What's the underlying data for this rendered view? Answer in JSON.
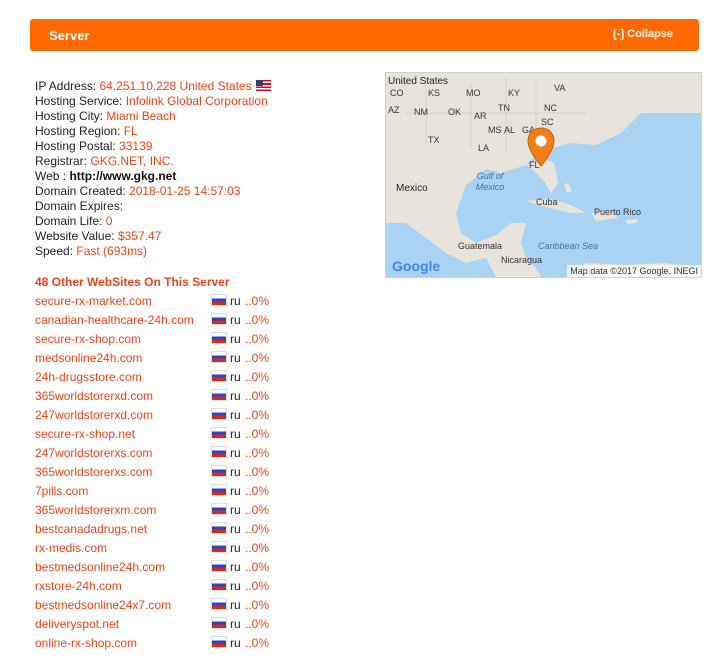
{
  "header": {
    "title": "Server",
    "collapse": "[-] Collapse"
  },
  "info": {
    "ip_label": "IP Address: ",
    "ip_value": "64.251.10.228 United States",
    "hosting_service_label": "Hosting Service: ",
    "hosting_service_value": "Infolink Global Corporation",
    "hosting_city_label": "Hosting City: ",
    "hosting_city_value": "Miami Beach",
    "hosting_region_label": "Hosting Region: ",
    "hosting_region_value": "FL",
    "hosting_postal_label": "Hosting Postal: ",
    "hosting_postal_value": "33139",
    "registrar_label": "Registrar: ",
    "registrar_value": "GKG.NET, INC.",
    "web_label": "Web : ",
    "web_value": "http://www.gkg.net",
    "domain_created_label": "Domain Created: ",
    "domain_created_value": "2018-01-25 14:57:03",
    "domain_expires_label": "Domain Expires:",
    "domain_life_label": "Domain Life: ",
    "domain_life_value": "0",
    "website_value_label": "Website Value: ",
    "website_value_value": "$357.47",
    "speed_label": "Speed: ",
    "speed_value": "Fast (693ms)"
  },
  "map": {
    "labels": {
      "us": "United States",
      "co": "CO",
      "ks": "KS",
      "mo": "MO",
      "ky": "KY",
      "va": "VA",
      "az": "AZ",
      "nm": "NM",
      "ok": "OK",
      "ar": "AR",
      "tn": "TN",
      "nc": "NC",
      "sc": "SC",
      "tx": "TX",
      "ms": "MS",
      "al": "AL",
      "ga": "GA",
      "la": "LA",
      "fl": "FL",
      "gulf": "Gulf of Mexico",
      "mexico": "Mexico",
      "cuba": "Cuba",
      "puerto_rico": "Puerto Rico",
      "guatemala": "Guatemala",
      "nicaragua": "Nicaragua",
      "caribbean": "Caribbean Sea"
    },
    "google": "Google",
    "attribution": "Map data ©2017 Google, INEGI",
    "marker_color": "#f07f1a"
  },
  "sites": {
    "title": "48 Other WebSites On This Server",
    "items": [
      {
        "domain": "secure-rx-market.com",
        "cc": "ru",
        "pct": "..0%"
      },
      {
        "domain": "canadian-healthcare-24h.com",
        "cc": "ru",
        "pct": "..0%"
      },
      {
        "domain": "secure-rx-shop.com",
        "cc": "ru",
        "pct": "..0%"
      },
      {
        "domain": "medsonline24h.com",
        "cc": "ru",
        "pct": "..0%"
      },
      {
        "domain": "24h-drugsstore.com",
        "cc": "ru",
        "pct": "..0%"
      },
      {
        "domain": "365worldstorerxd.com",
        "cc": "ru",
        "pct": "..0%"
      },
      {
        "domain": "247worldstorerxd.com",
        "cc": "ru",
        "pct": "..0%"
      },
      {
        "domain": "secure-rx-shop.net",
        "cc": "ru",
        "pct": "..0%"
      },
      {
        "domain": "247worldstorerxs.com",
        "cc": "ru",
        "pct": "..0%"
      },
      {
        "domain": "365worldstorerxs.com",
        "cc": "ru",
        "pct": "..0%"
      },
      {
        "domain": "7pills.com",
        "cc": "ru",
        "pct": "..0%"
      },
      {
        "domain": "365worldstorerxm.com",
        "cc": "ru",
        "pct": "..0%"
      },
      {
        "domain": "bestcanadadrugs.net",
        "cc": "ru",
        "pct": "..0%"
      },
      {
        "domain": "rx-medis.com",
        "cc": "ru",
        "pct": "..0%"
      },
      {
        "domain": "bestmedsonline24h.com",
        "cc": "ru",
        "pct": "..0%"
      },
      {
        "domain": "rxstore-24h.com",
        "cc": "ru",
        "pct": "..0%"
      },
      {
        "domain": "bestmedsonline24x7.com",
        "cc": "ru",
        "pct": "..0%"
      },
      {
        "domain": "deliveryspot.net",
        "cc": "ru",
        "pct": "..0%"
      },
      {
        "domain": "online-rx-shop.com",
        "cc": "ru",
        "pct": "..0%"
      }
    ]
  }
}
